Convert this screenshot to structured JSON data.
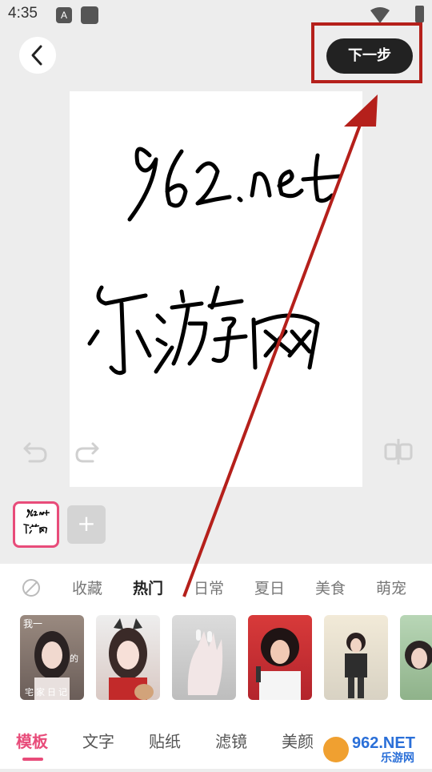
{
  "status_bar": {
    "time": "4:35",
    "notif_letter": "A"
  },
  "toolbar": {
    "next_label": "下一步"
  },
  "canvas": {
    "line1": "962.net",
    "line2": "乐游网"
  },
  "categories": {
    "items": [
      "收藏",
      "热门",
      "日常",
      "夏日",
      "美食",
      "萌宠"
    ],
    "active": "热门"
  },
  "template_texts": {
    "t1_top": "我一",
    "t1_bottom": "宅家日记",
    "t1_side": "的"
  },
  "tabs": {
    "items": [
      "模板",
      "文字",
      "贴纸",
      "滤镜",
      "美颜"
    ],
    "active": "模板"
  },
  "watermark": {
    "text": "962.NET",
    "sub": "乐游网"
  },
  "colors": {
    "accent": "#e84c7a",
    "annotation_red": "#b5201b",
    "next_bg": "#222222"
  },
  "icons": [
    "back-chevron-icon",
    "undo-icon",
    "redo-icon",
    "center-align-icon",
    "no-filter-icon",
    "plus-icon",
    "wifi-icon",
    "battery-icon"
  ]
}
